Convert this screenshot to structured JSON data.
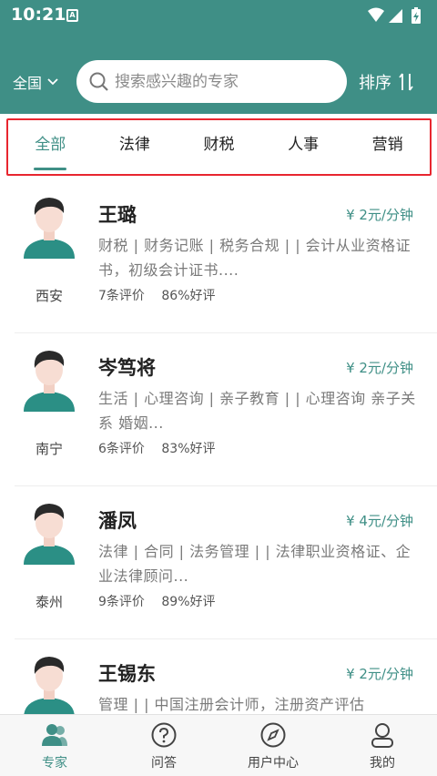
{
  "status": {
    "time": "10:21",
    "notification_icon": "a-notification-icon"
  },
  "header": {
    "region": "全国",
    "search_placeholder": "搜索感兴趣的专家",
    "sort_label": "排序"
  },
  "tabs": [
    {
      "label": "全部",
      "active": true
    },
    {
      "label": "法律",
      "active": false
    },
    {
      "label": "财税",
      "active": false
    },
    {
      "label": "人事",
      "active": false
    },
    {
      "label": "营销",
      "active": false
    }
  ],
  "experts": [
    {
      "name": "王璐",
      "price": "¥ 2元/分钟",
      "tags": "财税 | 财务记账 | 税务合规 |  | 会计从业资格证书，初级会计证书....",
      "city": "西安",
      "reviews": "7条评价",
      "rating": "86%好评"
    },
    {
      "name": "岑笃将",
      "price": "¥ 2元/分钟",
      "tags": "生活 | 心理咨询 | 亲子教育 |  | 心理咨询 亲子关系 婚姻...",
      "city": "南宁",
      "reviews": "6条评价",
      "rating": "83%好评"
    },
    {
      "name": "潘凤",
      "price": "¥ 4元/分钟",
      "tags": "法律 | 合同 | 法务管理 |  | 法律职业资格证、企业法律顾问...",
      "city": "泰州",
      "reviews": "9条评价",
      "rating": "89%好评"
    },
    {
      "name": "王锡东",
      "price": "¥ 2元/分钟",
      "tags": "管理 |  | 中国注册会计师，注册资产评估",
      "city": "",
      "reviews": "",
      "rating": ""
    }
  ],
  "bottom_nav": [
    {
      "label": "专家",
      "icon": "experts-icon",
      "active": true
    },
    {
      "label": "问答",
      "icon": "question-icon",
      "active": false
    },
    {
      "label": "用户中心",
      "icon": "compass-icon",
      "active": false
    },
    {
      "label": "我的",
      "icon": "profile-icon",
      "active": false
    }
  ],
  "colors": {
    "primary": "#3f8f86",
    "highlight_border": "#e8262f",
    "text_muted": "#7a7a7a"
  }
}
